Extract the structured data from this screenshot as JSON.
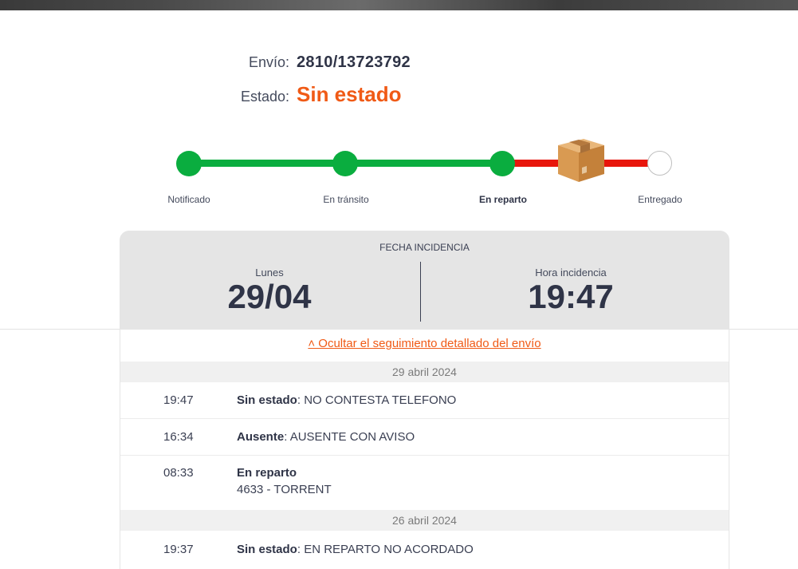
{
  "shipment": {
    "envio_label": "Envío:",
    "envio_value": "2810/13723792",
    "estado_label": "Estado:",
    "estado_value": "Sin estado"
  },
  "tracker": {
    "steps": [
      {
        "label": "Notificado",
        "state": "done"
      },
      {
        "label": "En tránsito",
        "state": "done"
      },
      {
        "label": "En reparto",
        "state": "current"
      },
      {
        "label": "Entregado",
        "state": "pending"
      }
    ],
    "icon": "package-box-icon",
    "colors": {
      "done": "#0aad3f",
      "remaining": "#e8160c"
    }
  },
  "incidence": {
    "caption": "FECHA INCIDENCIA",
    "day_label": "Lunes",
    "date_value": "29/04",
    "hour_label": "Hora incidencia",
    "hour_value": "19:47"
  },
  "details": {
    "toggle_text": "˄ Ocultar el seguimiento detallado del envío",
    "groups": [
      {
        "date": "29 abril 2024",
        "events": [
          {
            "time": "19:47",
            "status": "Sin estado",
            "desc": ": NO CONTESTA TELEFONO",
            "extra": ""
          },
          {
            "time": "16:34",
            "status": "Ausente",
            "desc": ": AUSENTE CON AVISO",
            "extra": ""
          },
          {
            "time": "08:33",
            "status": "En reparto",
            "desc": "",
            "extra": "4633 - TORRENT"
          }
        ]
      },
      {
        "date": "26 abril 2024",
        "events": [
          {
            "time": "19:37",
            "status": "Sin estado",
            "desc": ": EN REPARTO NO ACORDADO",
            "extra": ""
          }
        ]
      }
    ]
  },
  "accent_color": "#f05a16"
}
